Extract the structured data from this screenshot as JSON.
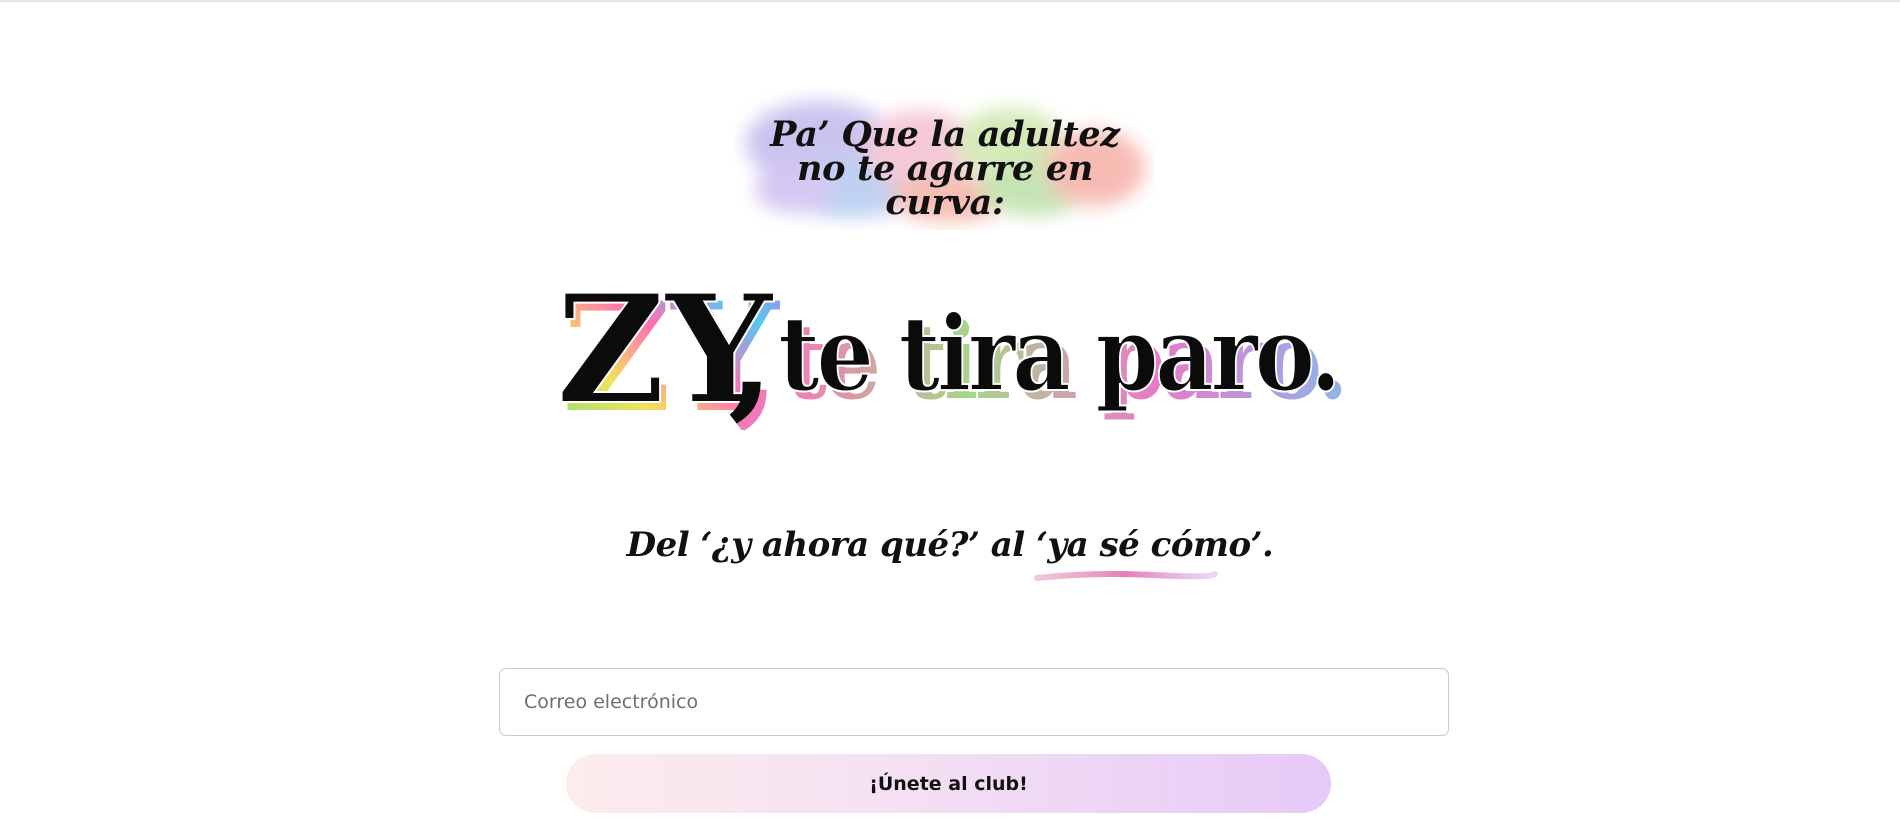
{
  "tagline": {
    "line1": "Pa’ Que la adultez",
    "line2": "no te agarre en curva:"
  },
  "hero": {
    "brand": "ZY",
    "comma": ",",
    "rest": "te tira paro."
  },
  "subtitle": {
    "prefix": "Del ‘¿y ahora qué?’ al ",
    "emphasis": "‘ya sé cómo’",
    "suffix": "."
  },
  "form": {
    "email_placeholder": "Correo electrónico",
    "submit_label": "¡Únete al club!"
  },
  "colors": {
    "accent_pink": "#e56fb0",
    "accent_lilac": "#e6c9f7",
    "splash_purple": "#b9a6e6",
    "splash_green": "#a8d98f",
    "splash_peach": "#f3a89a"
  }
}
